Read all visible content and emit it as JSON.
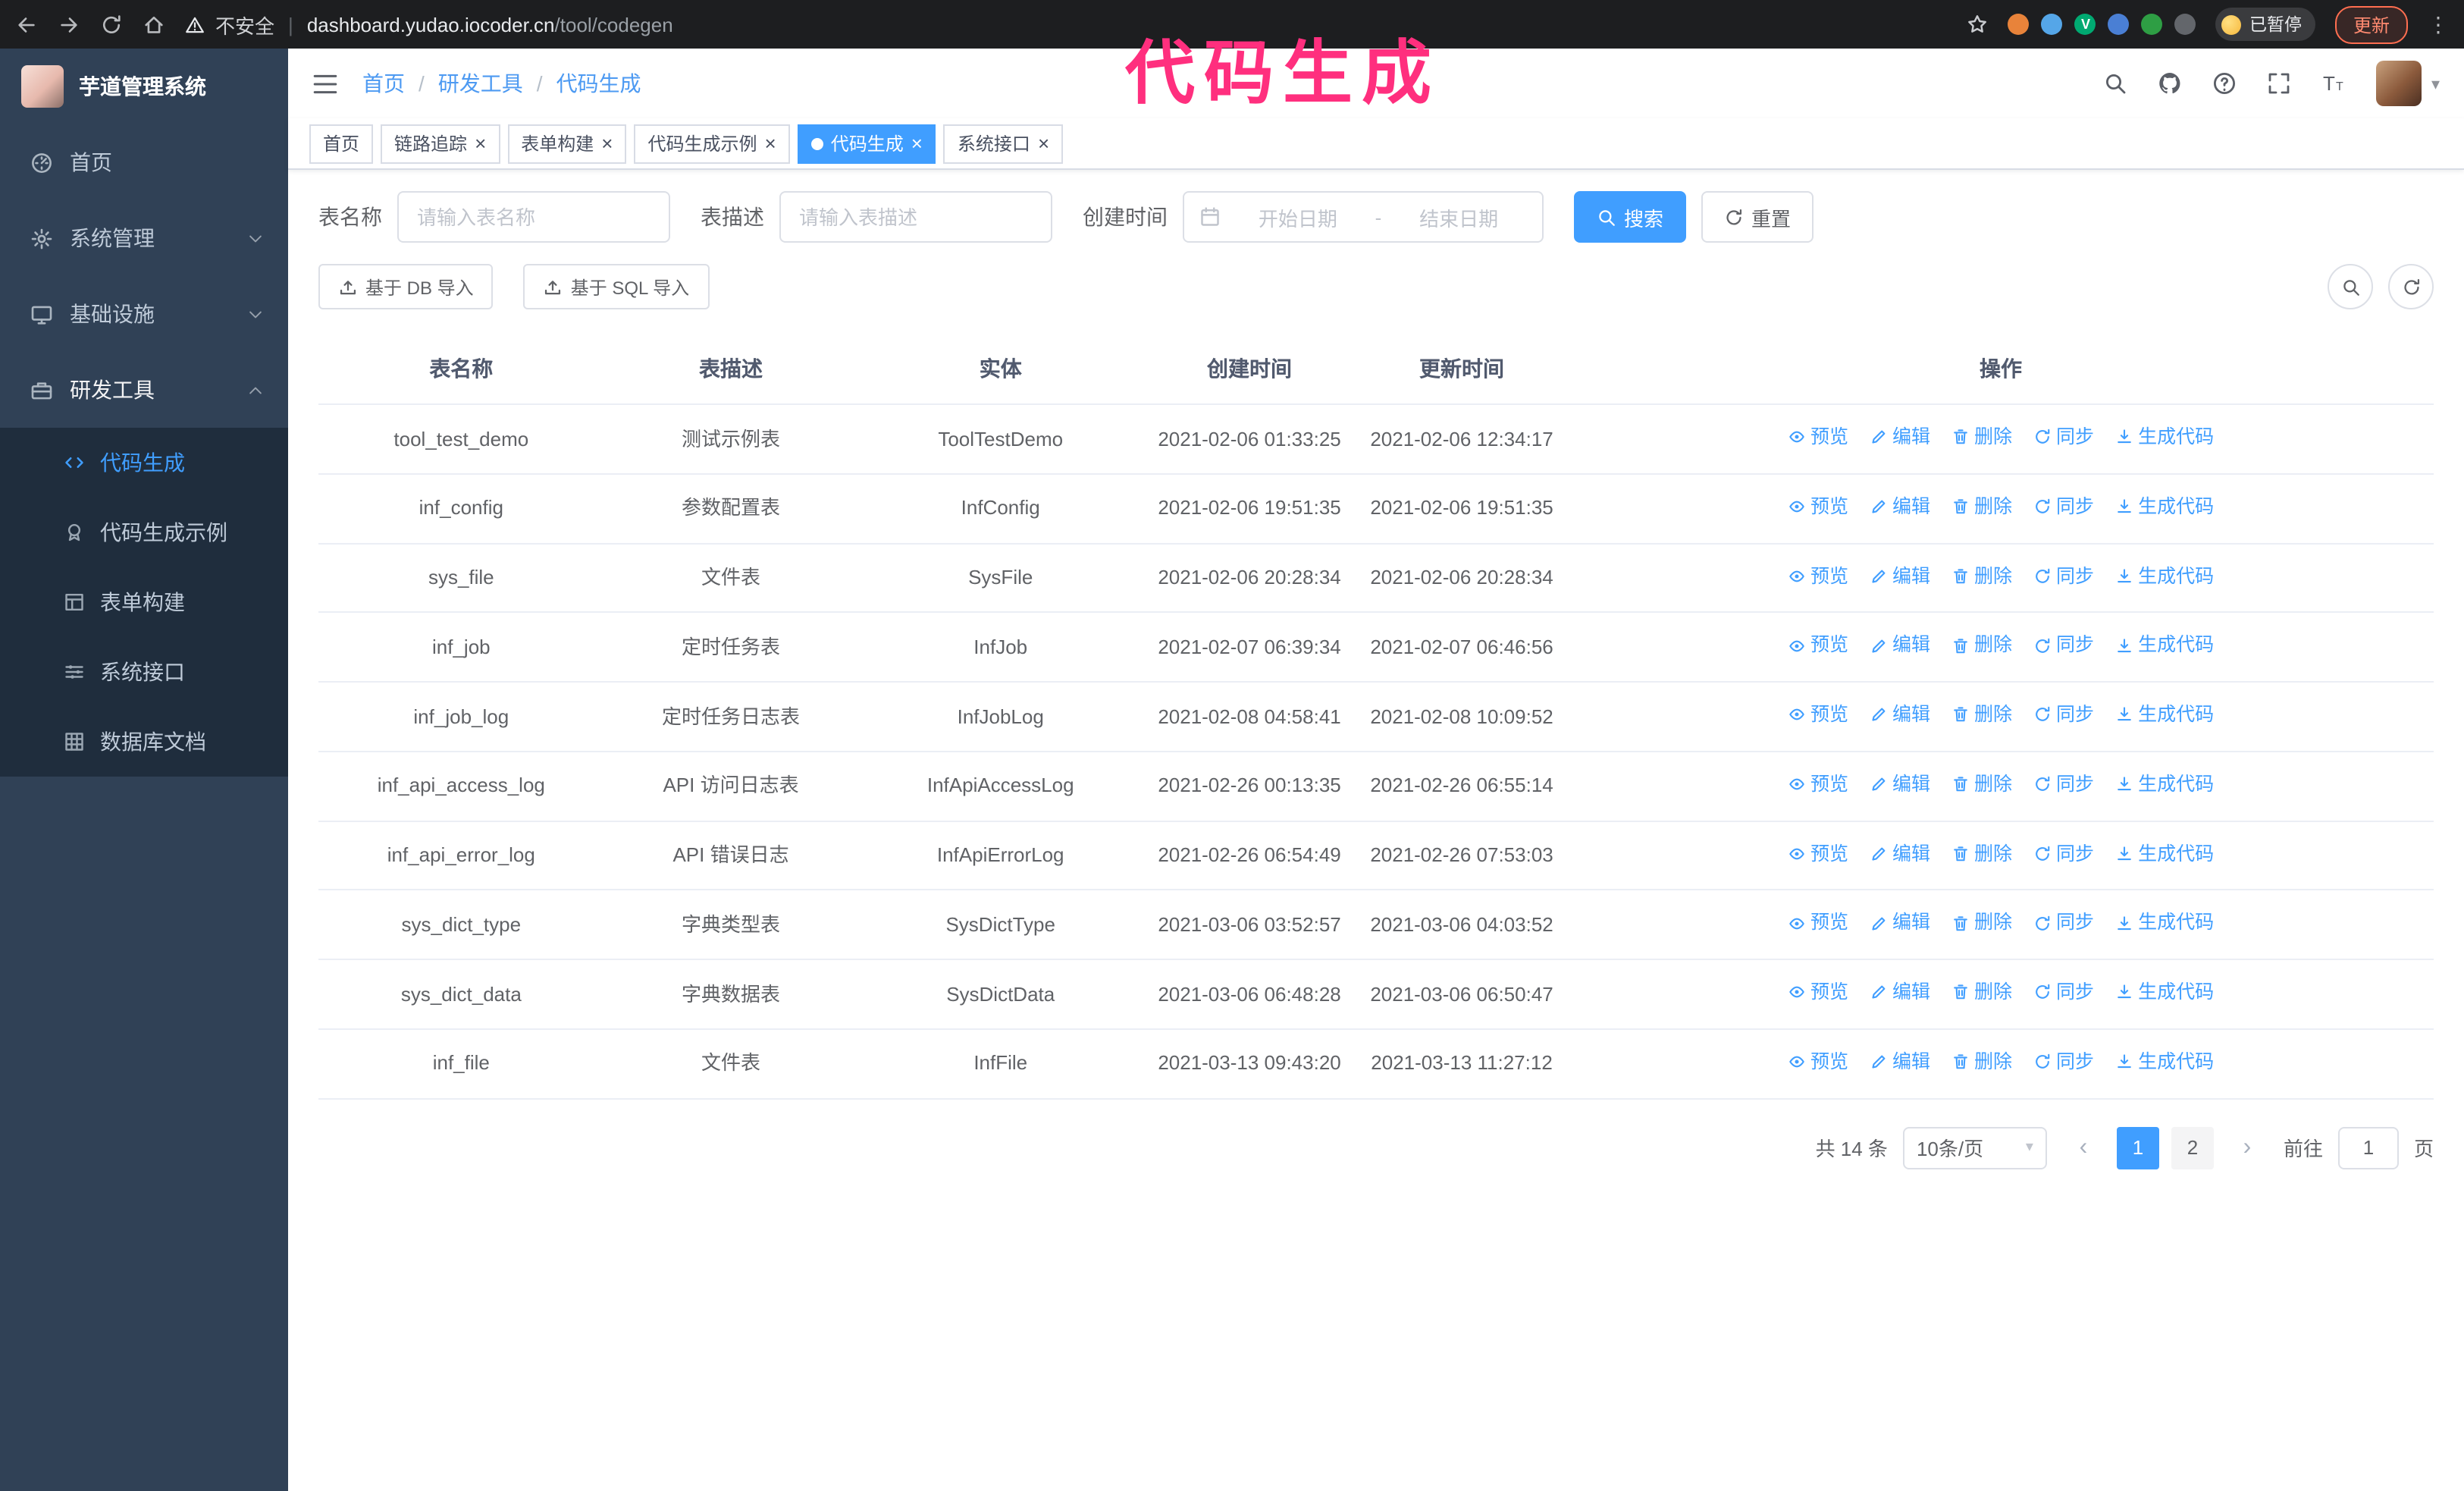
{
  "colors": {
    "accent": "#409eff",
    "annotation": "#ff2f7e",
    "sidebar_bg": "#304156",
    "submenu_bg": "#1f2d3d"
  },
  "annotation": {
    "text": "代码生成"
  },
  "browser": {
    "warning": "不安全",
    "url_host": "dashboard.yudao.iocoder.cn",
    "url_path": "/tool/codegen",
    "paused_badge": "已暂停",
    "update_button": "更新",
    "extensions": [
      {
        "name": "extension-icon-orange",
        "color": "#e8833a"
      },
      {
        "name": "extension-icon-blue",
        "color": "#55a6e8"
      },
      {
        "name": "extension-icon-green-v",
        "color": "#00a971",
        "letter": "V"
      },
      {
        "name": "extension-icon-indigo",
        "color": "#4a7fd4"
      },
      {
        "name": "extension-icon-leaf",
        "color": "#2e9e44"
      },
      {
        "name": "extension-icon-puzzle",
        "color": "#63666b"
      }
    ]
  },
  "sidebar": {
    "title": "芋道管理系统",
    "menu": [
      {
        "id": "home",
        "label": "首页",
        "icon": "dashboard",
        "expandable": false,
        "expanded": false
      },
      {
        "id": "system",
        "label": "系统管理",
        "icon": "gear",
        "expandable": true,
        "expanded": false
      },
      {
        "id": "infra",
        "label": "基础设施",
        "icon": "monitor",
        "expandable": true,
        "expanded": false
      },
      {
        "id": "devtools",
        "label": "研发工具",
        "icon": "toolbox",
        "expandable": true,
        "expanded": true
      }
    ],
    "submenu": [
      {
        "id": "codegen",
        "label": "代码生成",
        "icon": "code",
        "active": true
      },
      {
        "id": "codegen-example",
        "label": "代码生成示例",
        "icon": "badge",
        "active": false
      },
      {
        "id": "form-builder",
        "label": "表单构建",
        "icon": "form",
        "active": false
      },
      {
        "id": "system-api",
        "label": "系统接口",
        "icon": "sliders",
        "active": false
      },
      {
        "id": "db-doc",
        "label": "数据库文档",
        "icon": "grid",
        "active": false
      }
    ]
  },
  "breadcrumb": [
    "首页",
    "研发工具",
    "代码生成"
  ],
  "tabs": [
    {
      "label": "首页",
      "closable": false,
      "active": false
    },
    {
      "label": "链路追踪",
      "closable": true,
      "active": false
    },
    {
      "label": "表单构建",
      "closable": true,
      "active": false
    },
    {
      "label": "代码生成示例",
      "closable": true,
      "active": false
    },
    {
      "label": "代码生成",
      "closable": true,
      "active": true
    },
    {
      "label": "系统接口",
      "closable": true,
      "active": false
    }
  ],
  "filters": {
    "table_name_label": "表名称",
    "table_name_placeholder": "请输入表名称",
    "table_desc_label": "表描述",
    "table_desc_placeholder": "请输入表描述",
    "create_time_label": "创建时间",
    "date_start_placeholder": "开始日期",
    "date_separator": "-",
    "date_end_placeholder": "结束日期",
    "search_button": "搜索",
    "reset_button": "重置"
  },
  "toolbar": {
    "import_db": "基于 DB 导入",
    "import_sql": "基于 SQL 导入"
  },
  "table": {
    "columns": [
      "表名称",
      "表描述",
      "实体",
      "创建时间",
      "更新时间",
      "操作"
    ],
    "actions": [
      {
        "id": "preview",
        "label": "预览",
        "icon": "eye"
      },
      {
        "id": "edit",
        "label": "编辑",
        "icon": "edit"
      },
      {
        "id": "delete",
        "label": "删除",
        "icon": "trash"
      },
      {
        "id": "sync",
        "label": "同步",
        "icon": "reload"
      },
      {
        "id": "generate",
        "label": "生成代码",
        "icon": "download"
      }
    ],
    "rows": [
      {
        "name": "tool_test_demo",
        "desc": "测试示例表",
        "entity": "ToolTestDemo",
        "created": "2021-02-06 01:33:25",
        "updated": "2021-02-06 12:34:17"
      },
      {
        "name": "inf_config",
        "desc": "参数配置表",
        "entity": "InfConfig",
        "created": "2021-02-06 19:51:35",
        "updated": "2021-02-06 19:51:35"
      },
      {
        "name": "sys_file",
        "desc": "文件表",
        "entity": "SysFile",
        "created": "2021-02-06 20:28:34",
        "updated": "2021-02-06 20:28:34"
      },
      {
        "name": "inf_job",
        "desc": "定时任务表",
        "entity": "InfJob",
        "created": "2021-02-07 06:39:34",
        "updated": "2021-02-07 06:46:56"
      },
      {
        "name": "inf_job_log",
        "desc": "定时任务日志表",
        "entity": "InfJobLog",
        "created": "2021-02-08 04:58:41",
        "updated": "2021-02-08 10:09:52"
      },
      {
        "name": "inf_api_access_log",
        "desc": "API 访问日志表",
        "entity": "InfApiAccessLog",
        "created": "2021-02-26 00:13:35",
        "updated": "2021-02-26 06:55:14"
      },
      {
        "name": "inf_api_error_log",
        "desc": "API 错误日志",
        "entity": "InfApiErrorLog",
        "created": "2021-02-26 06:54:49",
        "updated": "2021-02-26 07:53:03"
      },
      {
        "name": "sys_dict_type",
        "desc": "字典类型表",
        "entity": "SysDictType",
        "created": "2021-03-06 03:52:57",
        "updated": "2021-03-06 04:03:52"
      },
      {
        "name": "sys_dict_data",
        "desc": "字典数据表",
        "entity": "SysDictData",
        "created": "2021-03-06 06:48:28",
        "updated": "2021-03-06 06:50:47"
      },
      {
        "name": "inf_file",
        "desc": "文件表",
        "entity": "InfFile",
        "created": "2021-03-13 09:43:20",
        "updated": "2021-03-13 11:27:12"
      }
    ]
  },
  "pagination": {
    "total_text": "共 14 条",
    "page_size_text": "10条/页",
    "pages": [
      "1",
      "2"
    ],
    "active_page": "1",
    "prev_symbol": "‹",
    "next_symbol": "›",
    "goto_label": "前往",
    "goto_value": "1",
    "unit_label": "页"
  }
}
